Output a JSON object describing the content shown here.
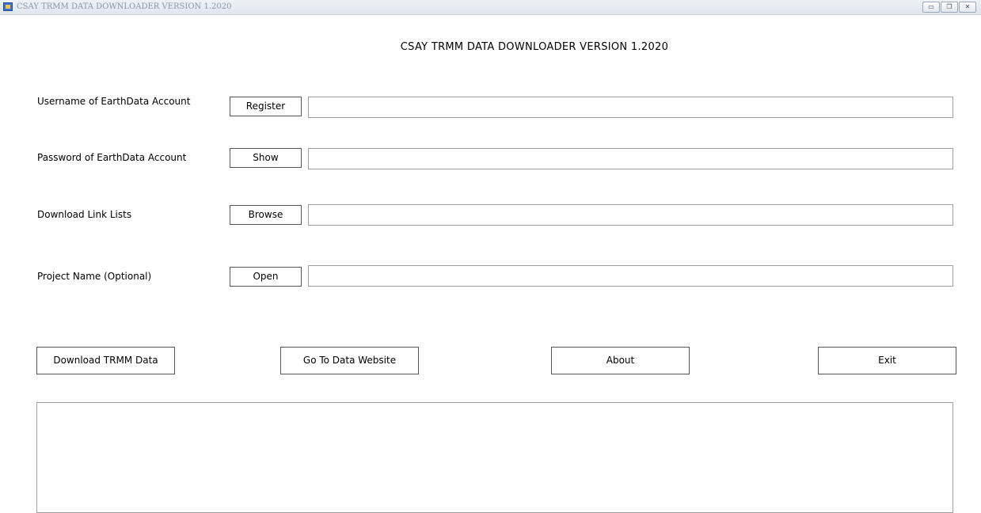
{
  "window": {
    "title": "CSAY TRMM DATA DOWNLOADER VERSION 1.2020",
    "controls": {
      "minimize_glyph": "▭",
      "restore_glyph": "❐",
      "close_glyph": "✕"
    }
  },
  "header": {
    "title": "CSAY TRMM DATA DOWNLOADER VERSION 1.2020"
  },
  "form": {
    "rows": [
      {
        "label": "Username of EarthData Account",
        "button": "Register",
        "value": ""
      },
      {
        "label": "Password of EarthData Account",
        "button": "Show",
        "value": ""
      },
      {
        "label": "Download Link Lists",
        "button": "Browse",
        "value": ""
      },
      {
        "label": "Project Name (Optional)",
        "button": "Open",
        "value": ""
      }
    ]
  },
  "actions": {
    "download": "Download TRMM Data",
    "website": "Go To Data Website",
    "about": "About",
    "exit": "Exit"
  },
  "log": {
    "text": ""
  }
}
